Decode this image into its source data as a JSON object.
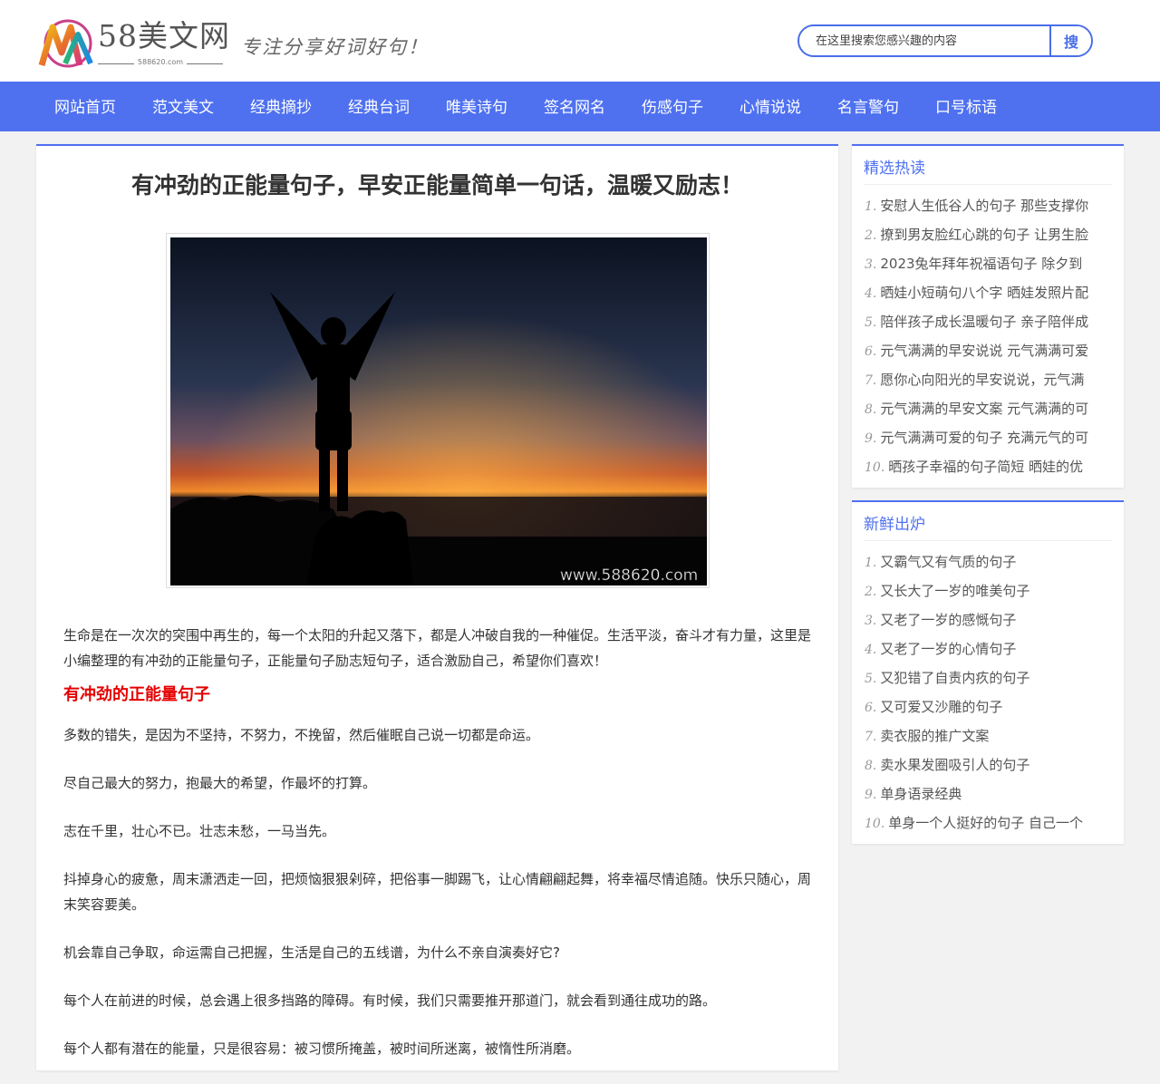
{
  "header": {
    "logo_text": "58美文网",
    "logo_domain": "588620.com",
    "slogan": "专注分享好词好句！",
    "search": {
      "placeholder": "在这里搜索您感兴趣的内容",
      "button_label": "搜"
    }
  },
  "nav": [
    "网站首页",
    "范文美文",
    "经典摘抄",
    "经典台词",
    "唯美诗句",
    "签名网名",
    "伤感句子",
    "心情说说",
    "名言警句",
    "口号标语"
  ],
  "article": {
    "title": "有冲劲的正能量句子，早安正能量简单一句话，温暖又励志！",
    "image_watermark": "www.588620.com",
    "intro": "生命是在一次次的突围中再生的，每一个太阳的升起又落下，都是人冲破自我的一种催促。生活平淡，奋斗才有力量，这里是小编整理的有冲劲的正能量句子，正能量句子励志短句子，适合激励自己，希望你们喜欢！",
    "section_heading": "有冲劲的正能量句子",
    "sentences": [
      "多数的错失，是因为不坚持，不努力，不挽留，然后催眠自己说一切都是命运。",
      "尽自己最大的努力，抱最大的希望，作最坏的打算。",
      "志在千里，壮心不已。壮志未愁，一马当先。",
      "抖掉身心的疲惫，周末潇洒走一回，把烦恼狠狠剁碎，把俗事一脚踢飞，让心情翩翩起舞，将幸福尽情追随。快乐只随心，周末笑容要美。",
      "机会靠自己争取，命运需自己把握，生活是自己的五线谱，为什么不亲自演奏好它?",
      "每个人在前进的时候，总会遇上很多挡路的障碍。有时候，我们只需要推开那道门，就会看到通往成功的路。",
      "每个人都有潜在的能量，只是很容易：被习惯所掩盖，被时间所迷离，被惰性所消磨。"
    ]
  },
  "sidebar": {
    "hot": {
      "title": "精选热读",
      "items": [
        {
          "num": "1.",
          "text": "安慰人生低谷人的句子 那些支撑你"
        },
        {
          "num": "2.",
          "text": "撩到男友脸红心跳的句子 让男生脸"
        },
        {
          "num": "3.",
          "text": "2023兔年拜年祝福语句子 除夕到"
        },
        {
          "num": "4.",
          "text": "晒娃小短萌句八个字 晒娃发照片配"
        },
        {
          "num": "5.",
          "text": "陪伴孩子成长温暖句子 亲子陪伴成"
        },
        {
          "num": "6.",
          "text": "元气满满的早安说说 元气满满可爱"
        },
        {
          "num": "7.",
          "text": "愿你心向阳光的早安说说，元气满"
        },
        {
          "num": "8.",
          "text": "元气满满的早安文案 元气满满的可"
        },
        {
          "num": "9.",
          "text": "元气满满可爱的句子 充满元气的可"
        },
        {
          "num": "10.",
          "text": "晒孩子幸福的句子简短 晒娃的优"
        }
      ]
    },
    "fresh": {
      "title": "新鲜出炉",
      "items": [
        {
          "num": "1.",
          "text": "又霸气又有气质的句子"
        },
        {
          "num": "2.",
          "text": "又长大了一岁的唯美句子"
        },
        {
          "num": "3.",
          "text": "又老了一岁的感慨句子"
        },
        {
          "num": "4.",
          "text": "又老了一岁的心情句子"
        },
        {
          "num": "5.",
          "text": "又犯错了自责内疚的句子"
        },
        {
          "num": "6.",
          "text": "又可爱又沙雕的句子"
        },
        {
          "num": "7.",
          "text": "卖衣服的推广文案"
        },
        {
          "num": "8.",
          "text": "卖水果发圈吸引人的句子"
        },
        {
          "num": "9.",
          "text": "单身语录经典"
        },
        {
          "num": "10.",
          "text": "单身一个人挺好的句子 自己一个"
        }
      ]
    }
  }
}
